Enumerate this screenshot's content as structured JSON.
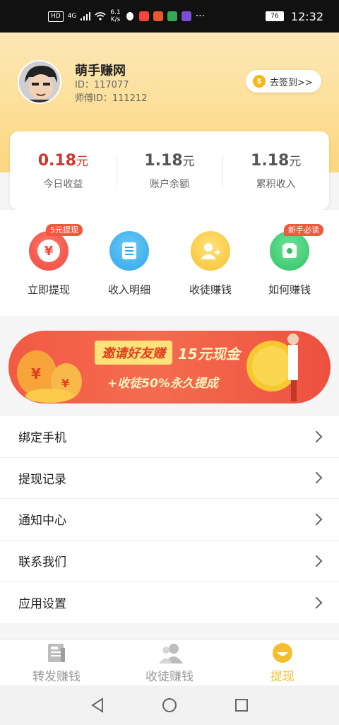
{
  "status_bar": {
    "hd": "HD",
    "network": "4G",
    "speed_value": "6.1",
    "speed_unit": "K/s",
    "battery": "76",
    "time": "12:32"
  },
  "user": {
    "name": "萌手赚网",
    "id_text": "ID：117077",
    "master_id_text": "师傅ID：111212"
  },
  "signin": {
    "label": "去签到>>",
    "coin_symbol": "$"
  },
  "earnings": [
    {
      "value": "0.18",
      "unit": "元",
      "label": "今日收益"
    },
    {
      "value": "1.18",
      "unit": "元",
      "label": "账户余额"
    },
    {
      "value": "1.18",
      "unit": "元",
      "label": "累积收入"
    }
  ],
  "actions": [
    {
      "label": "立即提现",
      "icon": "yen-icon",
      "glyph": "¥",
      "tag": "5元提现",
      "color": "#f25347"
    },
    {
      "label": "收入明细",
      "icon": "document-icon",
      "glyph": "",
      "tag": "",
      "color": "#36b2ee"
    },
    {
      "label": "收徒赚钱",
      "icon": "add-user-icon",
      "glyph": "",
      "tag": "",
      "color": "#f6c735"
    },
    {
      "label": "如何赚钱",
      "icon": "wallet-icon",
      "glyph": "",
      "tag": "新手必读",
      "color": "#3ecf72"
    }
  ],
  "banner": {
    "chip_text": "邀请好友赚",
    "amount_text": "15元现金",
    "subtitle": "+收徒50%永久提成"
  },
  "menu": [
    {
      "label": "绑定手机"
    },
    {
      "label": "提现记录"
    },
    {
      "label": "通知中心"
    },
    {
      "label": "联系我们"
    },
    {
      "label": "应用设置"
    }
  ],
  "tabs": [
    {
      "label": "转发赚钱",
      "icon": "news-icon",
      "active": false
    },
    {
      "label": "收徒赚钱",
      "icon": "users-icon",
      "active": false
    },
    {
      "label": "提现",
      "icon": "smile-icon",
      "active": true
    }
  ],
  "colors": {
    "accent": "#f3bf30",
    "today_red": "#d0342c",
    "header_top": "#fce8b7",
    "header_bottom": "#fcd77e"
  }
}
